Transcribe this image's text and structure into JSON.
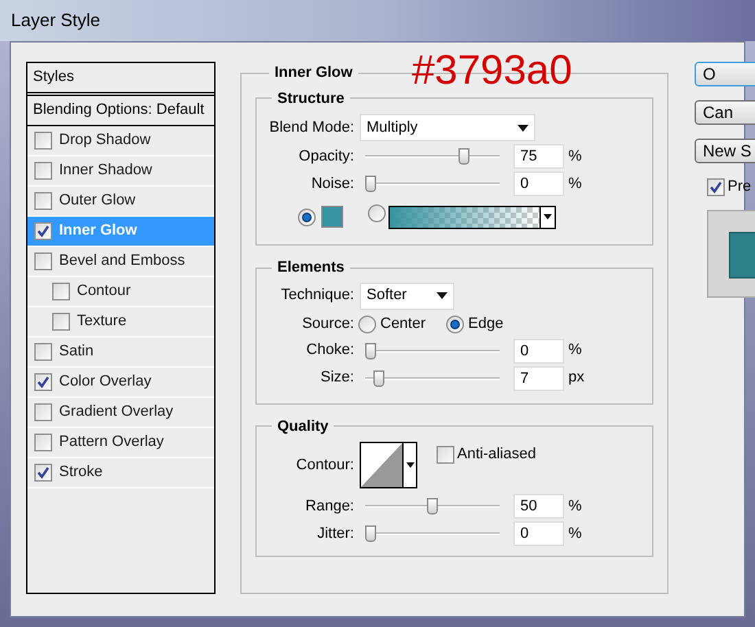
{
  "window": {
    "title": "Layer Style"
  },
  "styles_list": {
    "header": "Styles",
    "blending": "Blending Options: Default",
    "items": [
      {
        "label": "Drop Shadow",
        "checked": false,
        "selected": false
      },
      {
        "label": "Inner Shadow",
        "checked": false,
        "selected": false
      },
      {
        "label": "Outer Glow",
        "checked": false,
        "selected": false
      },
      {
        "label": "Inner Glow",
        "checked": true,
        "selected": true
      },
      {
        "label": "Bevel and Emboss",
        "checked": false,
        "selected": false,
        "children": [
          {
            "label": "Contour",
            "checked": false,
            "selected": false
          },
          {
            "label": "Texture",
            "checked": false,
            "selected": false
          }
        ]
      },
      {
        "label": "Satin",
        "checked": false,
        "selected": false
      },
      {
        "label": "Color Overlay",
        "checked": true,
        "selected": false
      },
      {
        "label": "Gradient Overlay",
        "checked": false,
        "selected": false
      },
      {
        "label": "Pattern Overlay",
        "checked": false,
        "selected": false
      },
      {
        "label": "Stroke",
        "checked": true,
        "selected": false
      }
    ]
  },
  "panel": {
    "title": "Inner Glow",
    "annotation": "#3793a0",
    "structure": {
      "title": "Structure",
      "blend_mode": {
        "label": "Blend Mode:",
        "value": "Multiply"
      },
      "opacity": {
        "label": "Opacity:",
        "level": 0.75,
        "value": "75",
        "unit": "%"
      },
      "noise": {
        "label": "Noise:",
        "level": 0,
        "value": "0",
        "unit": "%"
      },
      "color_fill": {
        "selected": true,
        "color": "#3793a0"
      },
      "gradient_fill": {
        "selected": false
      }
    },
    "elements": {
      "title": "Elements",
      "technique": {
        "label": "Technique:",
        "value": "Softer"
      },
      "source": {
        "label": "Source:",
        "options": [
          {
            "label": "Center",
            "selected": false
          },
          {
            "label": "Edge",
            "selected": true
          }
        ]
      },
      "choke": {
        "label": "Choke:",
        "level": 0,
        "value": "0",
        "unit": "%"
      },
      "size": {
        "label": "Size:",
        "level": 0.07,
        "value": "7",
        "unit": "px"
      }
    },
    "quality": {
      "title": "Quality",
      "contour": {
        "label": "Contour:"
      },
      "anti_aliased": {
        "label": "Anti-aliased",
        "checked": false
      },
      "range": {
        "label": "Range:",
        "level": 0.5,
        "value": "50",
        "unit": "%"
      },
      "jitter": {
        "label": "Jitter:",
        "level": 0,
        "value": "0",
        "unit": "%"
      }
    }
  },
  "buttons": [
    {
      "label": "O",
      "default": true
    },
    {
      "label": "Can",
      "default": false
    },
    {
      "label": "New S",
      "default": false
    }
  ],
  "preview": {
    "label": "Pre",
    "checked": true
  }
}
